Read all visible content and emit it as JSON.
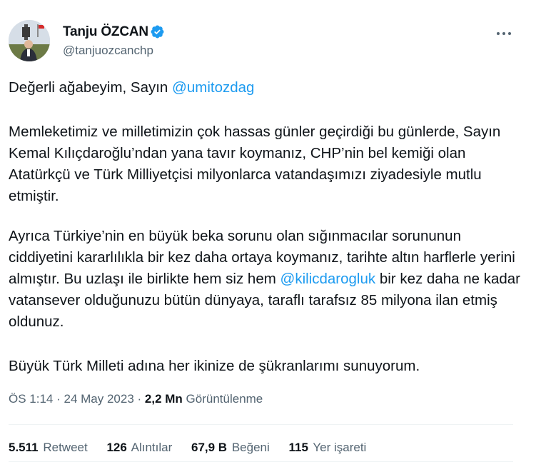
{
  "author": {
    "name": "Tanju ÖZCAN",
    "handle": "@tanjuozcanchp",
    "verified_color": "#1d9bf0"
  },
  "tweet": {
    "p1_before": "Değerli ağabeyim, Sayın ",
    "p1_mention": "@umitozdag",
    "p2": "Memleketimiz ve milletimizin çok hassas günler geçirdiği bu günlerde, Sayın Kemal Kılıçdaroğlu’ndan yana tavır koymanız, CHP’nin bel kemiği olan Atatürkçü ve Türk Milliyetçisi milyonlarca vatandaşımızı ziyadesiyle mutlu etmiştir.",
    "p3_before": "Ayrıca Türkiye’nin en büyük beka sorunu olan sığınmacılar sorununun ciddiyetini kararlılıkla bir kez daha ortaya koymanız, tarihte altın harflerle yerini almıştır. Bu uzlaşı ile birlikte hem siz hem ",
    "p3_mention": "@kilicdarogluk",
    "p3_after": " bir kez daha ne kadar vatansever olduğunuzu bütün dünyaya, taraflı tarafsız 85 milyona ilan etmiş oldunuz.",
    "p4": "Büyük Türk Milleti adına her ikinize de şükranlarımı sunuyorum."
  },
  "meta": {
    "time": "ÖS 1:14",
    "separator": " · ",
    "date": "24 May 2023",
    "views_count": "2,2 Mn",
    "views_label": "Görüntülenme"
  },
  "stats": [
    {
      "value": "5.511",
      "label": "Retweet"
    },
    {
      "value": "126",
      "label": "Alıntılar"
    },
    {
      "value": "67,9 B",
      "label": "Beğeni"
    },
    {
      "value": "115",
      "label": "Yer işareti"
    }
  ],
  "icons": {
    "avatar": "avatar",
    "verified": "verified-badge-icon",
    "more": "more-options-icon"
  },
  "colors": {
    "mention": "#1d9bf0",
    "secondary_text": "#536471",
    "primary_text": "#0f1419"
  }
}
